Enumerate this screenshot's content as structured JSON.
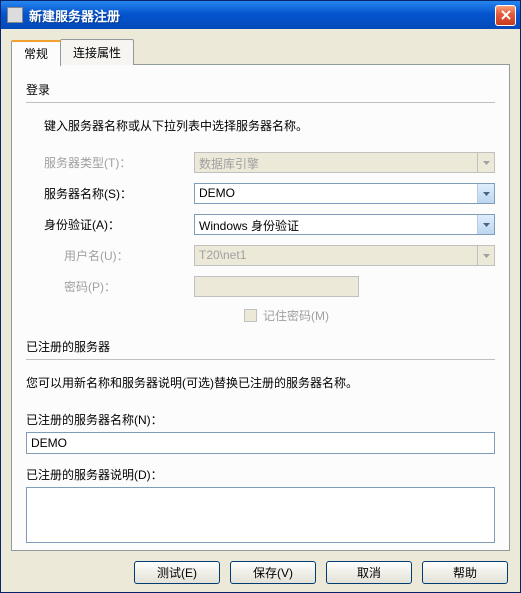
{
  "window": {
    "title": "新建服务器注册"
  },
  "tabs": {
    "general": "常规",
    "connprops": "连接属性"
  },
  "login": {
    "group": "登录",
    "instruction": "键入服务器名称或从下拉列表中选择服务器名称。",
    "server_type_label": "服务器类型(T)：",
    "server_type_value": "数据库引擎",
    "server_name_label": "服务器名称(S)：",
    "server_name_value": "DEMO",
    "auth_label": "身份验证(A)：",
    "auth_value": "Windows 身份验证",
    "username_label": "用户名(U)：",
    "username_value": "T20\\net1",
    "password_label": "密码(P)：",
    "password_value": "",
    "remember_label": "记住密码(M)"
  },
  "registered": {
    "group": "已注册的服务器",
    "instruction": "您可以用新名称和服务器说明(可选)替换已注册的服务器名称。",
    "name_label": "已注册的服务器名称(N)：",
    "name_value": "DEMO",
    "desc_label": "已注册的服务器说明(D)：",
    "desc_value": ""
  },
  "buttons": {
    "test": "测试(E)",
    "save": "保存(V)",
    "cancel": "取消",
    "help": "帮助"
  }
}
